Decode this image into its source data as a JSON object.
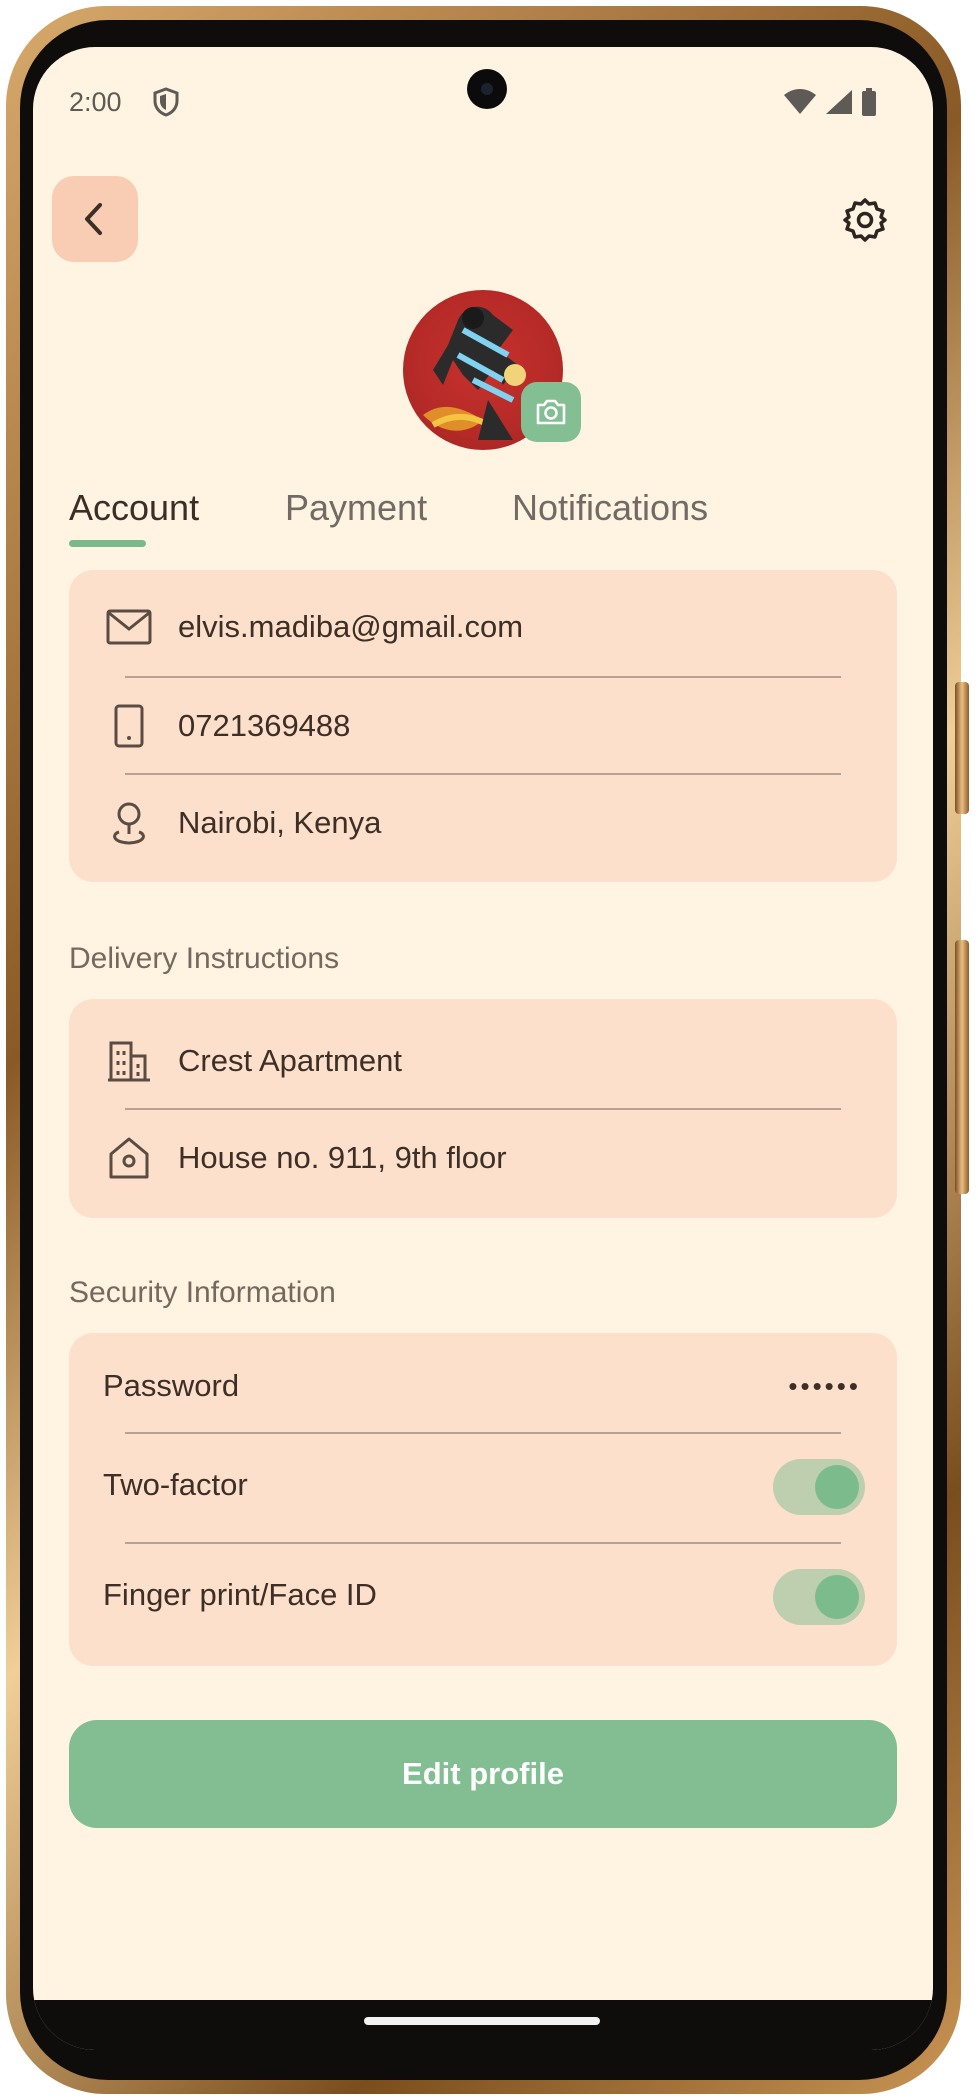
{
  "status_bar": {
    "time": "2:00",
    "icons": [
      "shield-icon",
      "wifi-icon",
      "signal-icon",
      "battery-icon"
    ]
  },
  "header": {
    "back_icon": "chevron-left-icon",
    "settings_icon": "gear-icon",
    "avatar_badge_icon": "camera-icon"
  },
  "tabs": [
    {
      "label": "Account",
      "active": true
    },
    {
      "label": "Payment",
      "active": false
    },
    {
      "label": "Notifications",
      "active": false
    }
  ],
  "account": {
    "email": "elvis.madiba@gmail.com",
    "phone": "0721369488",
    "location": "Nairobi, Kenya"
  },
  "delivery": {
    "title": "Delivery Instructions",
    "building": "Crest Apartment",
    "house": "House no. 911, 9th floor"
  },
  "security": {
    "title": "Security Information",
    "password_label": "Password",
    "password_mask": "••••••",
    "two_factor_label": "Two-factor",
    "two_factor_enabled": true,
    "biometric_label": "Finger print/Face ID",
    "biometric_enabled": true
  },
  "actions": {
    "edit_profile_label": "Edit profile"
  },
  "colors": {
    "background": "#fff4e2",
    "card": "#fce0cb",
    "accent_green": "#83bd92",
    "back_button": "#f8cdb3",
    "avatar_red": "#b52a27"
  }
}
